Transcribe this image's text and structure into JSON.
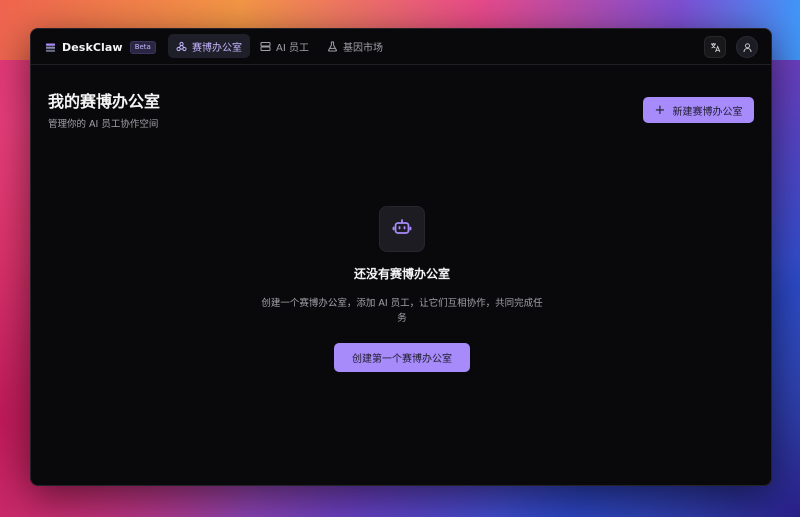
{
  "app": {
    "name": "DeskClaw",
    "badge": "Beta"
  },
  "nav": {
    "items": [
      {
        "label": "赛博办公室",
        "icon": "network-icon",
        "active": true
      },
      {
        "label": "AI 员工",
        "icon": "server-icon",
        "active": false
      },
      {
        "label": "基因市场",
        "icon": "flask-icon",
        "active": false
      }
    ]
  },
  "toolbar": {
    "language_icon": "translate-icon",
    "user_icon": "user-icon"
  },
  "page": {
    "title": "我的赛博办公室",
    "subtitle": "管理你的 AI 员工协作空间",
    "new_button": "新建赛博办公室"
  },
  "empty_state": {
    "icon": "bot-icon",
    "title": "还没有赛博办公室",
    "description": "创建一个赛博办公室，添加 AI 员工，让它们互相协作，共同完成任务",
    "button": "创建第一个赛博办公室"
  },
  "colors": {
    "accent": "#a78bfa",
    "accent_text": "#c4b5fd",
    "window_bg": "#09090b"
  }
}
